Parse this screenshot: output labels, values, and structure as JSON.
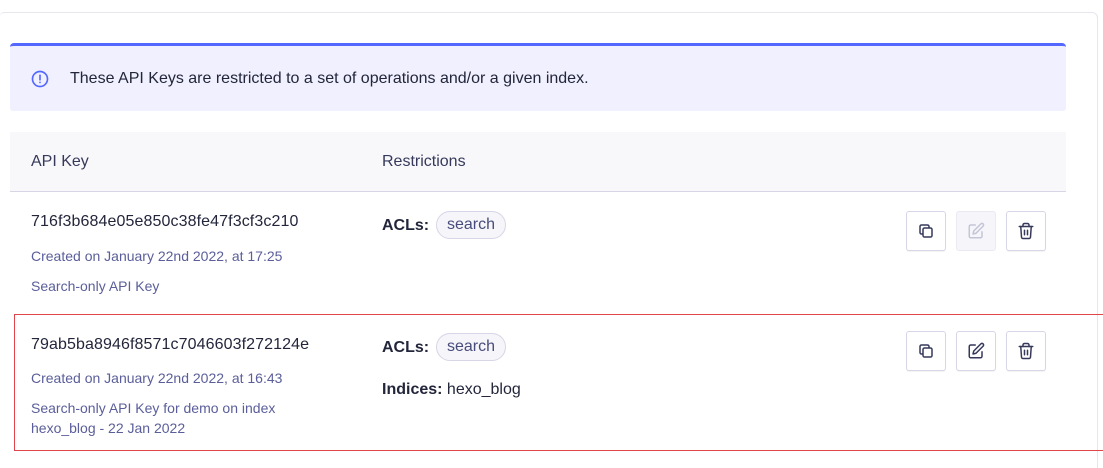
{
  "banner": {
    "text": "These API Keys are restricted to a set of operations and/or a given index.",
    "icon": "info-circle-icon",
    "accent": "#5468ff"
  },
  "table": {
    "columns": [
      "API Key",
      "Restrictions"
    ],
    "rows": [
      {
        "key": "716f3b684e05e850c38fe47f3cf3c210",
        "created": "Created on January 22nd 2022, at 17:25",
        "description_lines": [
          "Search-only API Key"
        ],
        "acl_label": "ACLs:",
        "acls": [
          "search"
        ],
        "indices_label": "",
        "indices": "",
        "actions": {
          "copy_enabled": true,
          "edit_enabled": false,
          "delete_enabled": true
        }
      },
      {
        "key": "79ab5ba8946f8571c7046603f272124e",
        "created": "Created on January 22nd 2022, at 16:43",
        "description_lines": [
          "Search-only API Key for demo on index",
          "hexo_blog - 22 Jan 2022"
        ],
        "acl_label": "ACLs:",
        "acls": [
          "search"
        ],
        "indices_label": "Indices:",
        "indices": "hexo_blog",
        "actions": {
          "copy_enabled": true,
          "edit_enabled": true,
          "delete_enabled": true
        }
      }
    ]
  },
  "colors": {
    "highlight_border": "#e0454c",
    "banner_bg": "#f0f0fe"
  }
}
